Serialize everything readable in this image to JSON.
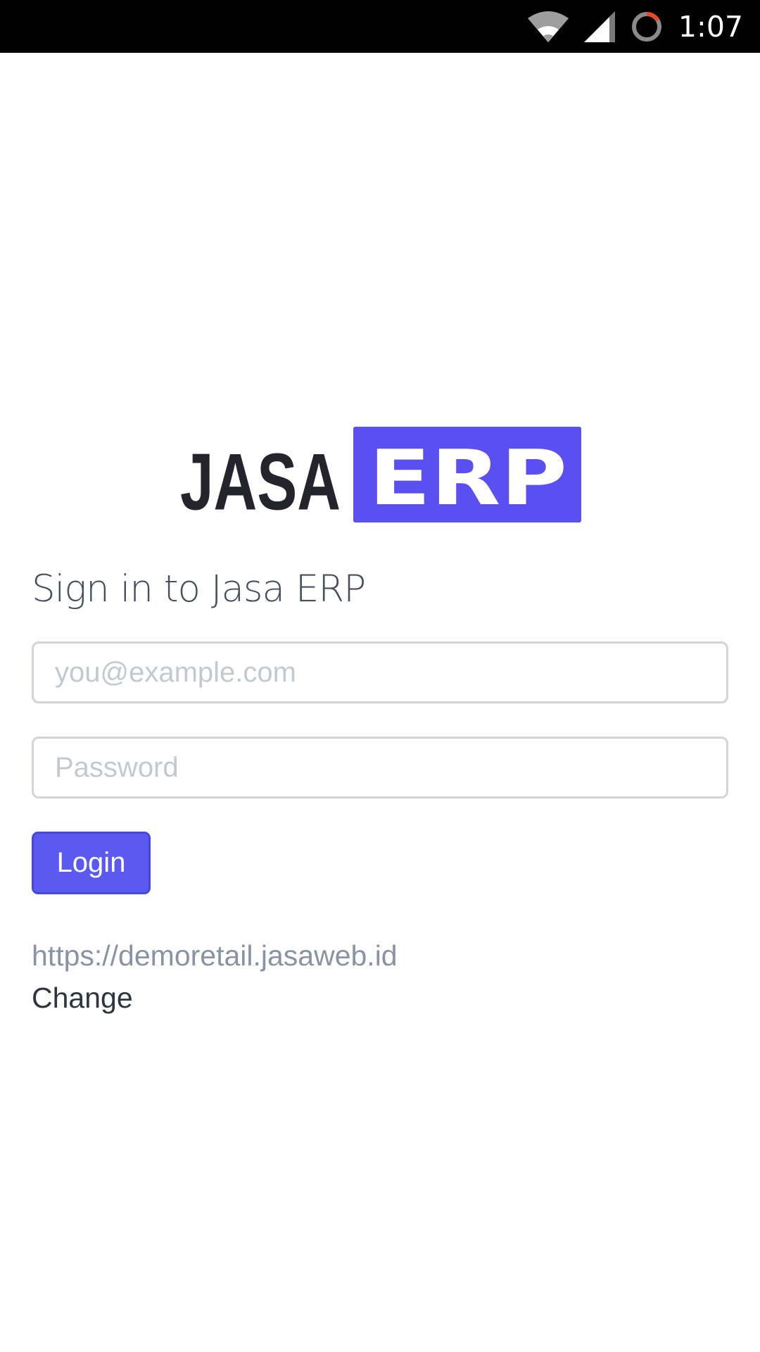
{
  "status_bar": {
    "time": "1:07",
    "icons": [
      "wifi-icon",
      "cell-signal-icon",
      "sync-loading-icon"
    ]
  },
  "logo": {
    "text_left": "JASA",
    "text_right": "ERP",
    "colors": {
      "dark": "#24242c",
      "accent": "#5a4ff0"
    }
  },
  "login": {
    "title": "Sign in to Jasa ERP",
    "email_placeholder": "you@example.com",
    "password_placeholder": "Password",
    "button_label": "Login"
  },
  "server": {
    "url": "https://demoretail.jasaweb.id",
    "change_label": "Change"
  },
  "colors": {
    "primary": "#5a5af0",
    "input_border": "#d1d5db",
    "muted_text": "#8a93a3"
  }
}
